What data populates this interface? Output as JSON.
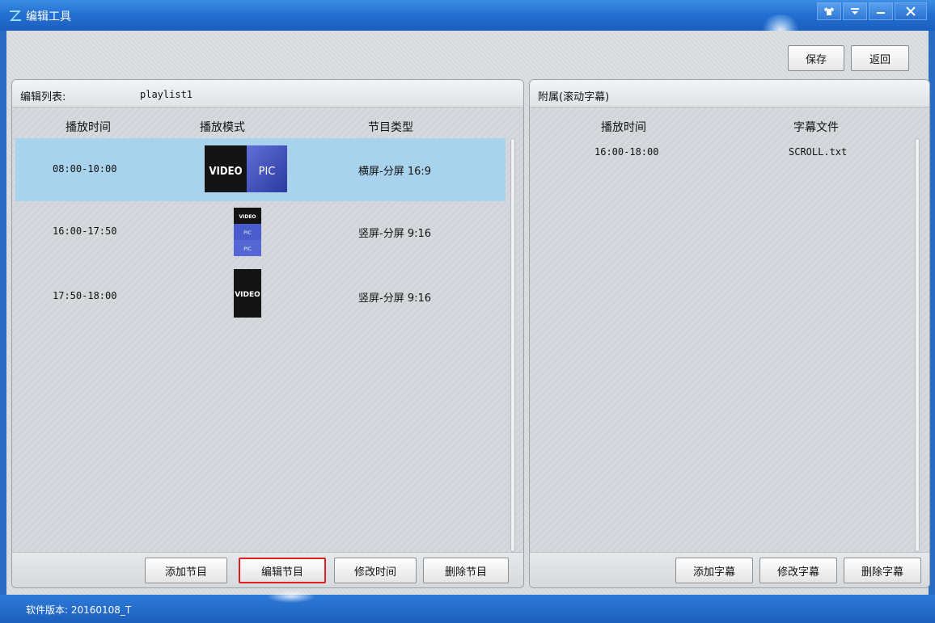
{
  "window": {
    "title": "编辑工具",
    "controls": [
      "skin-icon",
      "menu-icon",
      "minimize-icon",
      "close-icon"
    ]
  },
  "toolbar": {
    "save_label": "保存",
    "back_label": "返回"
  },
  "left_panel": {
    "title": "编辑列表:",
    "playlist_name": "playlist1",
    "columns": [
      "播放时间",
      "播放模式",
      "节目类型"
    ],
    "rows": [
      {
        "time": "08:00-10:00",
        "mode_icon": "video-pic-horizontal-icon",
        "type": "横屏-分屏 16:9",
        "selected": true
      },
      {
        "time": "16:00-17:50",
        "mode_icon": "video-pic-pic-vertical-icon",
        "type": "竖屏-分屏 9:16",
        "selected": false
      },
      {
        "time": "17:50-18:00",
        "mode_icon": "video-vertical-icon",
        "type": "竖屏-分屏 9:16",
        "selected": false
      }
    ],
    "buttons": {
      "add": "添加节目",
      "edit": "编辑节目",
      "modify_time": "修改时间",
      "delete": "删除节目"
    }
  },
  "right_panel": {
    "title": "附属(滚动字幕)",
    "columns": [
      "播放时间",
      "字幕文件"
    ],
    "rows": [
      {
        "time": "16:00-18:00",
        "file": "SCROLL.txt"
      }
    ],
    "buttons": {
      "add": "添加字幕",
      "modify": "修改字幕",
      "delete": "删除字幕"
    }
  },
  "thumb_labels": {
    "video": "VIDEO",
    "pic": "PIC"
  },
  "status": {
    "version": "软件版本: 20160108_T"
  },
  "colors": {
    "titlebar": "#2370d2",
    "selected_row": "#a9d3ec",
    "highlight_border": "#e02020"
  }
}
